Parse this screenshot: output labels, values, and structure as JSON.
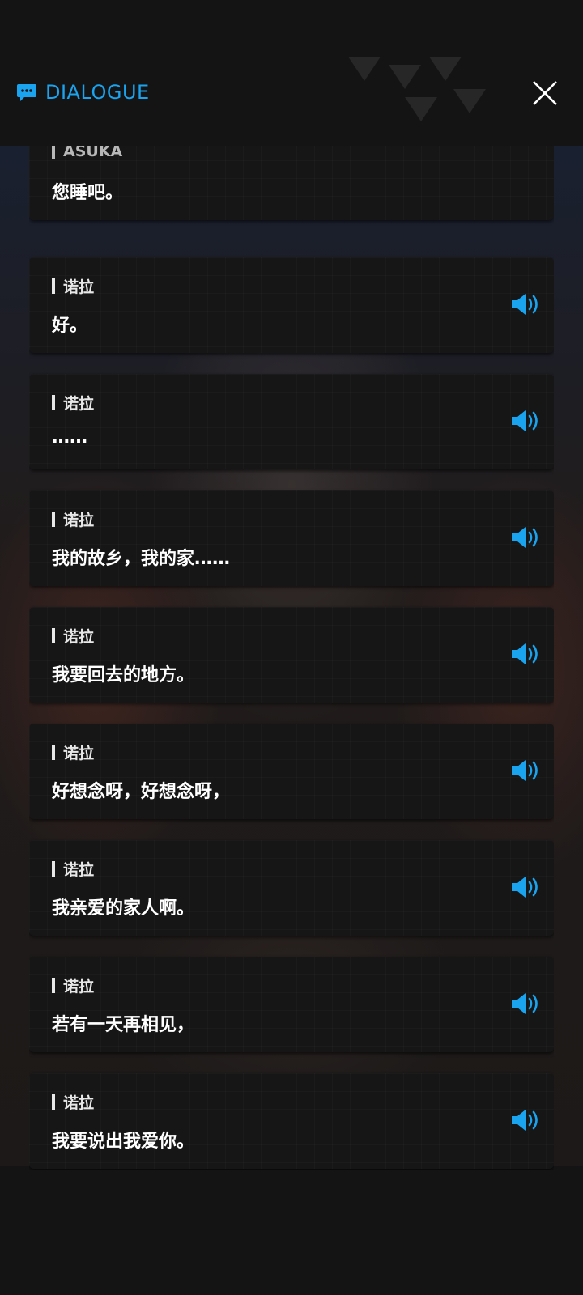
{
  "header": {
    "title": "DIALOGUE",
    "accent_color": "#1aa3ee",
    "icon": "chat-bubble-icon",
    "close_icon": "close-icon"
  },
  "dialogue": [
    {
      "speaker": "ASUKA",
      "text": "您睡吧。",
      "has_voice": false
    },
    {
      "speaker": "诺拉",
      "text": "好。",
      "has_voice": true
    },
    {
      "speaker": "诺拉",
      "text": "……",
      "has_voice": true
    },
    {
      "speaker": "诺拉",
      "text": "我的故乡，我的家……",
      "has_voice": true
    },
    {
      "speaker": "诺拉",
      "text": "我要回去的地方。",
      "has_voice": true
    },
    {
      "speaker": "诺拉",
      "text": "好想念呀，好想念呀，",
      "has_voice": true
    },
    {
      "speaker": "诺拉",
      "text": "我亲爱的家人啊。",
      "has_voice": true
    },
    {
      "speaker": "诺拉",
      "text": "若有一天再相见，",
      "has_voice": true
    },
    {
      "speaker": "诺拉",
      "text": "我要说出我爱你。",
      "has_voice": true
    }
  ]
}
